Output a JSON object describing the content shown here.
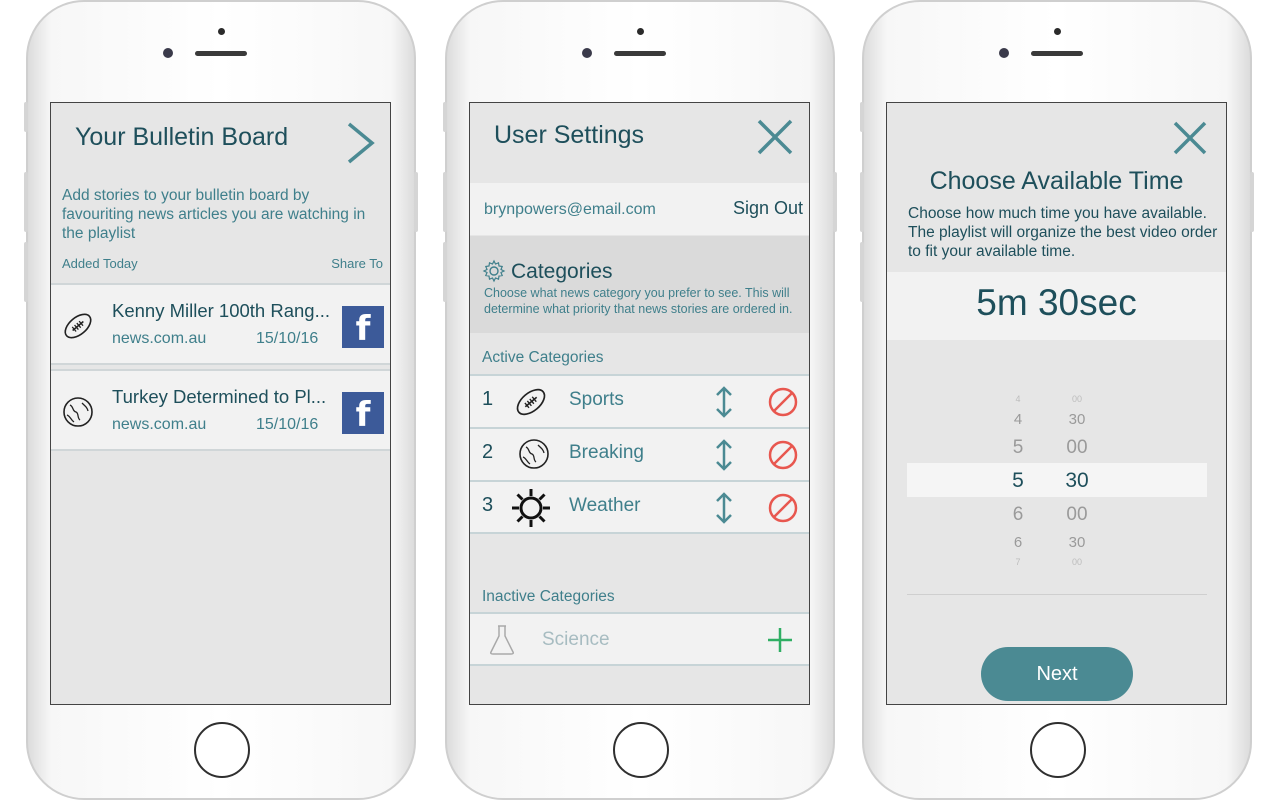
{
  "bulletin": {
    "title": "Your Bulletin Board",
    "description": "Add stories to your bulletin board by favouriting news articles you are watching in the playlist",
    "added_label": "Added Today",
    "share_label": "Share To",
    "stories": [
      {
        "headline": "Kenny Miller 100th Rang...",
        "source": "news.com.au",
        "date": "15/10/16",
        "icon": "football-icon",
        "share": "f"
      },
      {
        "headline": "Turkey Determined to Pl...",
        "source": "news.com.au",
        "date": "15/10/16",
        "icon": "globe-icon",
        "share": "f"
      }
    ]
  },
  "settings": {
    "title": "User Settings",
    "email": "brynpowers@email.com",
    "sign_out": "Sign Out",
    "categories_title": "Categories",
    "categories_desc": "Choose what news category you prefer to see. This will determine what priority that news stories are ordered in.",
    "active_label": "Active Categories",
    "active": [
      {
        "num": "1",
        "label": "Sports",
        "icon": "football-icon"
      },
      {
        "num": "2",
        "label": "Breaking",
        "icon": "globe-icon"
      },
      {
        "num": "3",
        "label": "Weather",
        "icon": "sun-icon"
      }
    ],
    "inactive_label": "Inactive Categories",
    "inactive": [
      {
        "label": "Science",
        "icon": "flask-icon"
      }
    ]
  },
  "time": {
    "title": "Choose Available Time",
    "description": "Choose how much time you have available. The playlist will organize the best video order to fit your available time.",
    "selected": "5m 30sec",
    "picker_minutes": [
      "4",
      "4",
      "5",
      "5",
      "6",
      "6",
      "7"
    ],
    "picker_seconds": [
      "00",
      "30",
      "00",
      "30",
      "00",
      "30",
      "00"
    ],
    "next": "Next"
  },
  "colors": {
    "primary_text": "#1e4f5b",
    "secondary_text": "#3f7f8b",
    "accent": "#4b8a93",
    "facebook": "#3c5a99",
    "remove": "#e8574f",
    "add": "#2fae63"
  }
}
